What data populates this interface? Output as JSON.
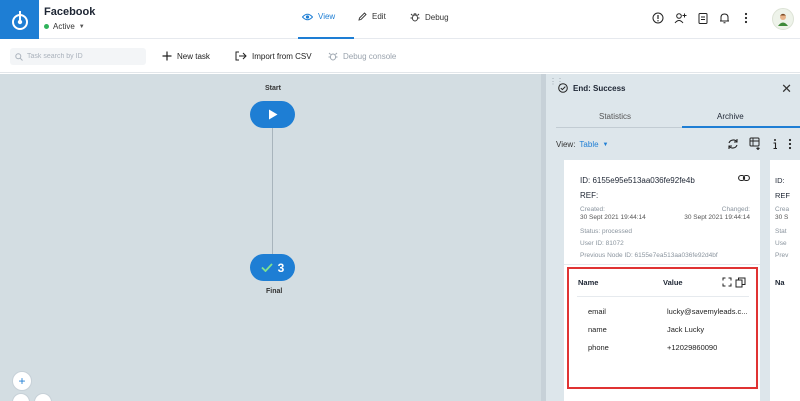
{
  "header": {
    "app_title": "Facebook",
    "status_label": "Active",
    "tabs": [
      {
        "label": "View",
        "icon": "eye-icon"
      },
      {
        "label": "Edit",
        "icon": "pencil-icon"
      },
      {
        "label": "Debug",
        "icon": "bug-icon"
      }
    ],
    "active_tab": "View",
    "right_icons": [
      "info-icon",
      "add-user-icon",
      "clipboard-icon",
      "bell-icon",
      "more-vertical-icon"
    ],
    "colors": {
      "accent": "#1e7ed4",
      "status_active": "#2fb35b"
    }
  },
  "toolbar": {
    "search_placeholder": "Task search by ID",
    "new_task_label": "New task",
    "import_label": "Import from CSV",
    "debug_console_label": "Debug console"
  },
  "canvas": {
    "start_label": "Start",
    "final_label": "Final",
    "final_count": "3",
    "zoom_in": "+"
  },
  "panel": {
    "title": "End: Success",
    "tabs": [
      "Statistics",
      "Archive"
    ],
    "active_tab": "Archive",
    "view_label": "View:",
    "view_value": "Table",
    "card": {
      "id": "ID: 6155e95e513aa036fe92fe4b",
      "ref": "REF:",
      "created_label": "Created:",
      "created_value": "30 Sept 2021 19:44:14",
      "changed_label": "Changed:",
      "changed_value": "30 Sept 2021 19:44:14",
      "status": "Status: processed",
      "user_id": "User ID: 81072",
      "prev_node_id": "Previous Node ID: 6155e7ea513aa036fe92d4bf",
      "table_headers": {
        "name": "Name",
        "value": "Value"
      },
      "rows": [
        {
          "name": "email",
          "value": "lucky@savemyleads.c..."
        },
        {
          "name": "name",
          "value": "Jack Lucky"
        },
        {
          "name": "phone",
          "value": "+12029860090"
        }
      ]
    },
    "card2": {
      "id": "ID:",
      "ref": "REF",
      "created": "Crea",
      "created_value": "30 S",
      "status": "Stat",
      "user": "Use",
      "prev": "Prev",
      "name_header": "Na"
    }
  }
}
